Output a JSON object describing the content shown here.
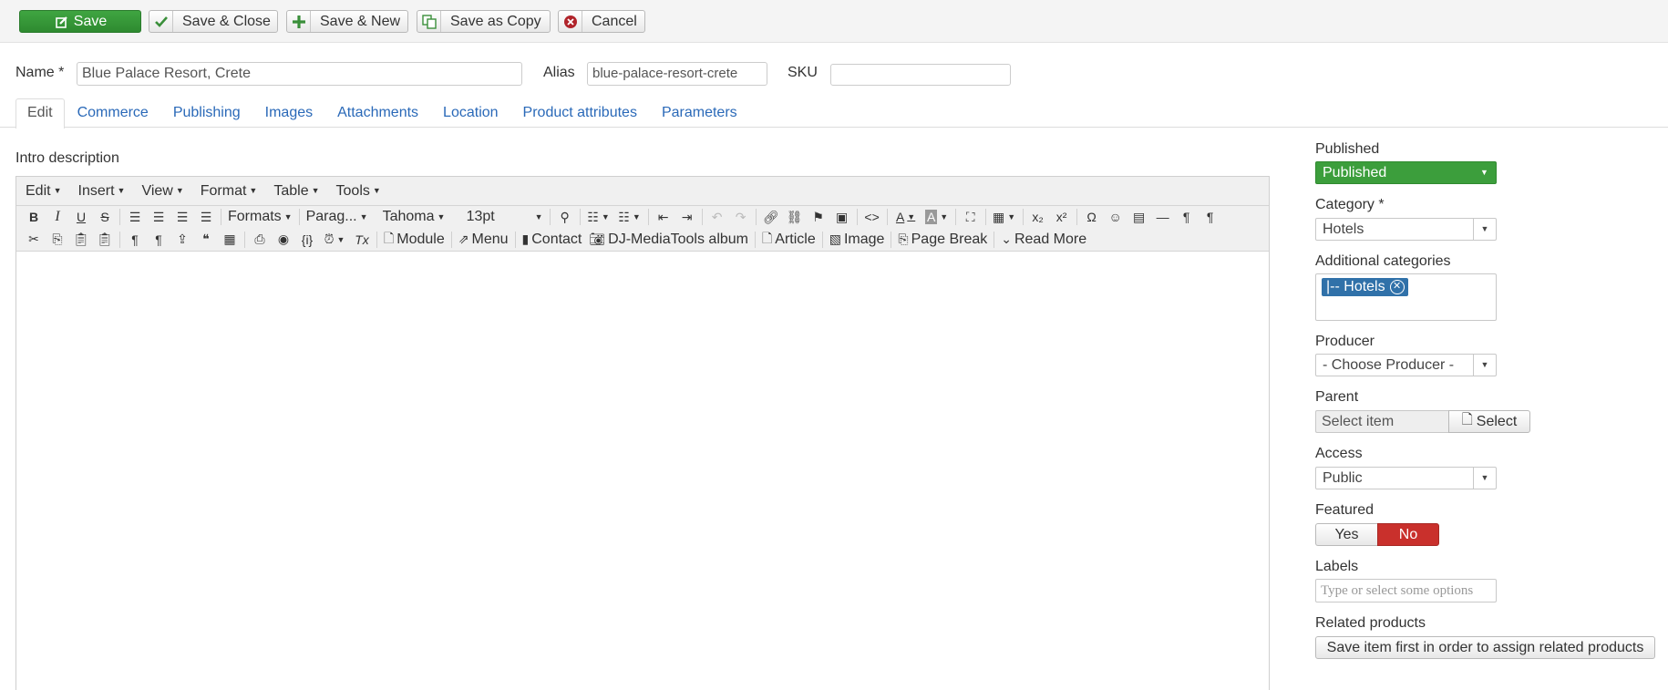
{
  "toolbar": {
    "save": "Save",
    "save_close": "Save & Close",
    "save_new": "Save & New",
    "save_copy": "Save as Copy",
    "cancel": "Cancel"
  },
  "form": {
    "name_label": "Name *",
    "name_value": "Blue Palace Resort, Crete",
    "alias_label": "Alias",
    "alias_value": "blue-palace-resort-crete",
    "sku_label": "SKU",
    "sku_value": ""
  },
  "tabs": [
    "Edit",
    "Commerce",
    "Publishing",
    "Images",
    "Attachments",
    "Location",
    "Product attributes",
    "Parameters"
  ],
  "editor": {
    "label": "Intro description",
    "menus": [
      "Edit",
      "Insert",
      "View",
      "Format",
      "Table",
      "Tools"
    ],
    "formats": "Formats",
    "paragraph": "Parag...",
    "font": "Tahoma",
    "size": "13pt",
    "buttons": {
      "module": "Module",
      "menu": "Menu",
      "contact": "Contact",
      "djmedia": "DJ-MediaTools album",
      "article": "Article",
      "image": "Image",
      "pagebreak": "Page Break",
      "readmore": "Read More"
    }
  },
  "sidebar": {
    "published_label": "Published",
    "published_value": "Published",
    "category_label": "Category *",
    "category_value": "Hotels",
    "additional_label": "Additional categories",
    "additional_chip": "|-- Hotels",
    "producer_label": "Producer",
    "producer_value": "- Choose Producer -",
    "parent_label": "Parent",
    "parent_placeholder": "Select item",
    "parent_button": "Select",
    "access_label": "Access",
    "access_value": "Public",
    "featured_label": "Featured",
    "featured_yes": "Yes",
    "featured_no": "No",
    "labels_label": "Labels",
    "labels_placeholder": "Type or select some options",
    "related_label": "Related products",
    "related_button": "Save item first in order to assign related products"
  },
  "colors": {
    "accent_green": "#3c9e3c",
    "danger_red": "#c9302c",
    "link_blue": "#2a69b8",
    "chip_blue": "#3071a9"
  }
}
